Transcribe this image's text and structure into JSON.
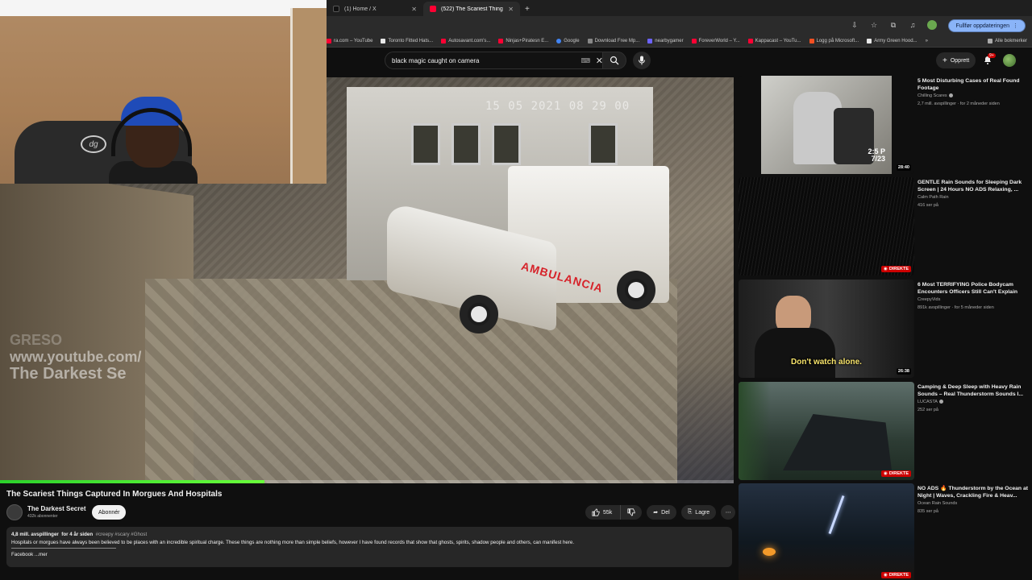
{
  "browser": {
    "tabs": [
      {
        "title": "(1) Home / X",
        "active": false,
        "favicon_color": "#111111"
      },
      {
        "title": "(522) The Scariest Things",
        "active": true,
        "favicon_color": "#ff0033"
      }
    ],
    "new_tab": "+",
    "update_button": "Fullfør oppdateringen",
    "bookmarks": [
      {
        "label": "ra.com – YouTube",
        "color": "#ff0033"
      },
      {
        "label": "Toronto Fitted Hats...",
        "color": "#e8e8e8"
      },
      {
        "label": "Autosavant.com's...",
        "color": "#ff0033"
      },
      {
        "label": "Ninjas+Piratesn E...",
        "color": "#ff0033"
      },
      {
        "label": "Google",
        "color": "#4285f4"
      },
      {
        "label": "Download Free Mp...",
        "color": "#888888"
      },
      {
        "label": "nearbygamer",
        "color": "#6c63ff"
      },
      {
        "label": "ForeverWorld – Y...",
        "color": "#ff0033"
      },
      {
        "label": "Kappacast – YouTu...",
        "color": "#ff0033"
      },
      {
        "label": "Logg på Microsoft...",
        "color": "#f25022"
      },
      {
        "label": "Army Green Hood...",
        "color": "#e8e8e8"
      }
    ],
    "bookmarks_more": "»",
    "bookmarks_all": "Alle bokmerker"
  },
  "youtube": {
    "search": {
      "query": "black magic  caught on camera"
    },
    "create_label": "Opprett",
    "notification_count": "9+"
  },
  "video": {
    "cctv_timestamp": "15 05 2021 08 29 00",
    "ambulance_text": "AMBULANCIA",
    "watermark": [
      "GRESO",
      "www.youtube.com/",
      "The Darkest Se"
    ],
    "progress_fraction": 0.36,
    "title": "The Scariest Things Captured In Morgues And Hospitals",
    "channel": {
      "name": "The Darkest Secret",
      "subscribers": "432k abonnenter"
    },
    "subscribe_label": "Abonnér",
    "actions": {
      "likes": "55k",
      "share": "Del",
      "save": "Lagre"
    },
    "description": {
      "views": "4,8 mill. avspillinger",
      "age": "for 4 år siden",
      "tags": "#creepy #scary #Ghost",
      "text": "Hospitals or morgues have always been believed to be places with an incredible spiritual charge. These things are nothing more than simple beliefs, however I have found records that show that ghosts, spirits, shadow people and others, can manifest here.",
      "facebook": "Facebook",
      "more": "...mer"
    }
  },
  "webcam": {
    "chair_logo": "dg"
  },
  "recommendations": [
    {
      "title": "5 Most Disturbing Cases of Real Found Footage",
      "channel": "Chilling Scares",
      "verified": true,
      "meta": "2,7 mill. avspillinger · for 2 måneder siden",
      "duration": "28:40",
      "live": false,
      "thumb_overlay": "2:5 P\n7/23"
    },
    {
      "title": "GENTLE Rain Sounds for Sleeping Dark Screen | 24 Hours NO ADS Relaxing, ...",
      "channel": "Calm Path Rain",
      "verified": false,
      "meta": "416 ser på",
      "duration": "",
      "live": true,
      "live_label": "DIREKTE"
    },
    {
      "title": "6 Most TERRIFYING Police Bodycam Encounters Officers Still Can't Explain",
      "channel": "CreepyVids",
      "verified": false,
      "meta": "891k avspillinger · for 5 måneder siden",
      "duration": "26:38",
      "live": false,
      "thumb_caption": "Don't watch alone."
    },
    {
      "title": "Camping & Deep Sleep with Heavy Rain Sounds – Real Thunderstorm Sounds I...",
      "channel": "LUCASTA",
      "verified": true,
      "meta": "252 ser på",
      "duration": "",
      "live": true,
      "live_label": "DIREKTE"
    },
    {
      "title": "NO ADS 🔥 Thunderstorm by the Ocean at Night | Waves, Crackling Fire & Heav...",
      "channel": "Ocean Rain Sounds",
      "verified": false,
      "meta": "835 ser på",
      "duration": "",
      "live": true,
      "live_label": "DIREKTE"
    }
  ]
}
